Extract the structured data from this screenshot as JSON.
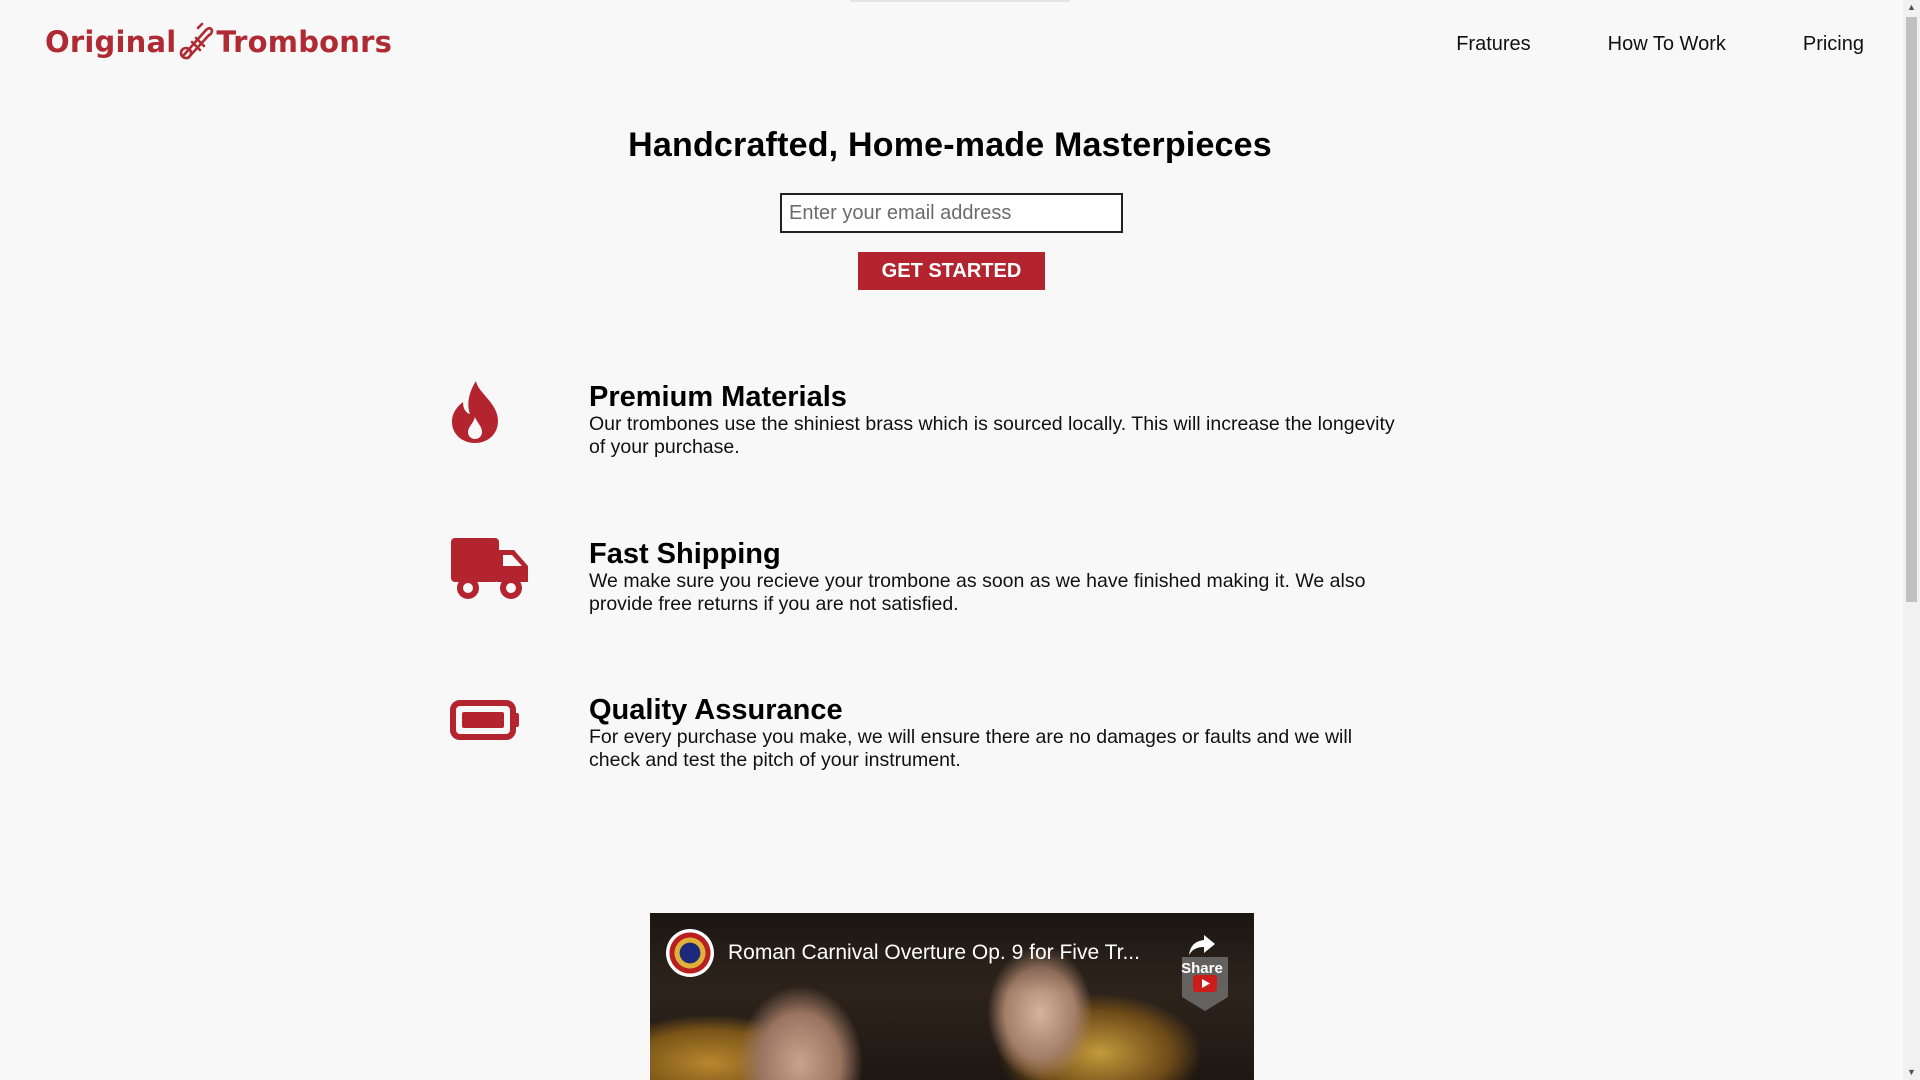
{
  "header": {
    "logo_left": "Original",
    "logo_right": "Trombonrs",
    "logo_icon": "trombone-icon",
    "nav": [
      {
        "label": "Fratures"
      },
      {
        "label": "How To Work"
      },
      {
        "label": "Pricing"
      }
    ]
  },
  "hero": {
    "title": "Handcrafted, Home-made Masterpieces",
    "email_placeholder": "Enter your email address",
    "email_value": "",
    "cta_label": "GET STARTED"
  },
  "features": [
    {
      "icon": "fire-icon",
      "title": "Premium Materials",
      "text": "Our trombones use the shiniest brass which is sourced locally. This will increase the longevity of your purchase."
    },
    {
      "icon": "truck-icon",
      "title": "Fast Shipping",
      "text": "We make sure you recieve your trombone as soon as we have finished making it. We also provide free returns if you are not satisfied."
    },
    {
      "icon": "battery-icon",
      "title": "Quality Assurance",
      "text": "For every purchase you make, we will ensure there are no damages or faults and we will check and test the pitch of your instrument."
    }
  ],
  "video": {
    "title": "Roman Carnival Overture Op. 9 for Five Tr...",
    "share_label": "Share"
  },
  "colors": {
    "accent": "#b3242f",
    "background": "#f8f8f8",
    "text": "#000000"
  }
}
